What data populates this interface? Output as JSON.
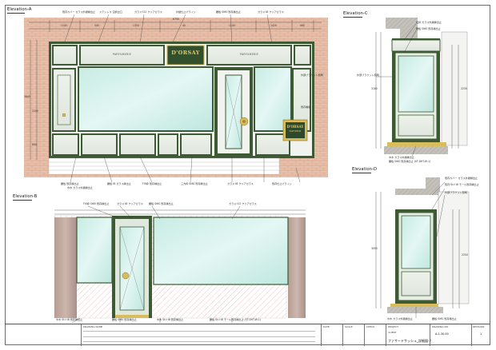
{
  "sheet": {
    "sheet_title": "ファサードサッシュ_詳細図-2",
    "sheet_number": "A-1-30-00",
    "revision": "1",
    "title_block_labels": [
      "DRAWING NAME",
      "DATE",
      "SCALE",
      "CHECK",
      "DRAWING NO.",
      "REVISION",
      "PROJECT",
      "CLIENT"
    ]
  },
  "elevations": {
    "a": {
      "title": "Elevation-A"
    },
    "b": {
      "title": "Elevation-B"
    },
    "c": {
      "title": "Elevation-C"
    },
    "d": {
      "title": "Elevation-D"
    }
  },
  "signage": {
    "brand": "D'ORSAY",
    "panel_left": "PARFUMERIE",
    "panel_right": "PARFUMERIE",
    "sign_brand": "D'ORSAY",
    "sign_sub": "PARFUMEUR"
  },
  "annotations": {
    "a_top": [
      "既存カバー ガラス外額縁出止",
      "ステンレス 空調出口",
      "ガラス t12 クリアガラス",
      "外壁仕上げライン",
      "腰板 St60 既存縁出止",
      "ガラス t8 クリアガラス"
    ],
    "a_right": [
      "外部ブラケット照明",
      "既存看板"
    ],
    "a_bottom": [
      "腰板 既存縁出止",
      "巾木 ガラス外額縁出止",
      "腰板 t8 ガラス縁出止",
      "FIX枠 既存縁出止",
      "三方枠 St60 既存縁出止",
      "ガラス t8 クリアガラス",
      "既存仕上げライン"
    ],
    "b_top": [
      "FIX枠 St60 既存縁出止",
      "ガラス t8 クリアガラス",
      "腰板 St60 既存縁出止",
      "ガラス t12 クリアガラス"
    ],
    "b_bottom": [
      "巾木 St-t t8 既存縁出止",
      "腰板 St60 既存縁出止",
      "巾木 St-t t8 既存縁出止",
      "腰板 St-t t8 モール既存縁出止 (ST-DHT-W-1)"
    ],
    "c_left": [
      "庇枠 ガラス外額縁出止",
      "腰板 St60 既存縁出止",
      "外部ブラケット照明"
    ],
    "c_bottom": [
      "巾木 ガラス外額縁出止",
      "腰板 St60 既存縁出止 (ST-DHT-W-1)"
    ],
    "d_left": [
      "既存カバー ガラス外額縁出止",
      "既存 St-t t8 モール既存縁出止",
      "外部ブラケット照明"
    ],
    "d_bottom": [
      "巾木 ガラス外額縁出止",
      "腰板 St60 既存縁出止"
    ]
  },
  "dimensions": {
    "a_widths": [
      "6750",
      "1145",
      "545",
      "1350",
      "40",
      "1140",
      "1420",
      "480"
    ],
    "a_heights": [
      "3845",
      "2200",
      "600"
    ],
    "c_heights": [
      "3160",
      "2235"
    ],
    "d_heights": [
      "3050",
      "2250"
    ]
  },
  "colors": {
    "frame_green": "#3e5a34",
    "glass": "#cfeee8",
    "brick": "#e6b9a4",
    "gold": "#d8bd5a",
    "wall_grey": "#b5b2aa"
  }
}
